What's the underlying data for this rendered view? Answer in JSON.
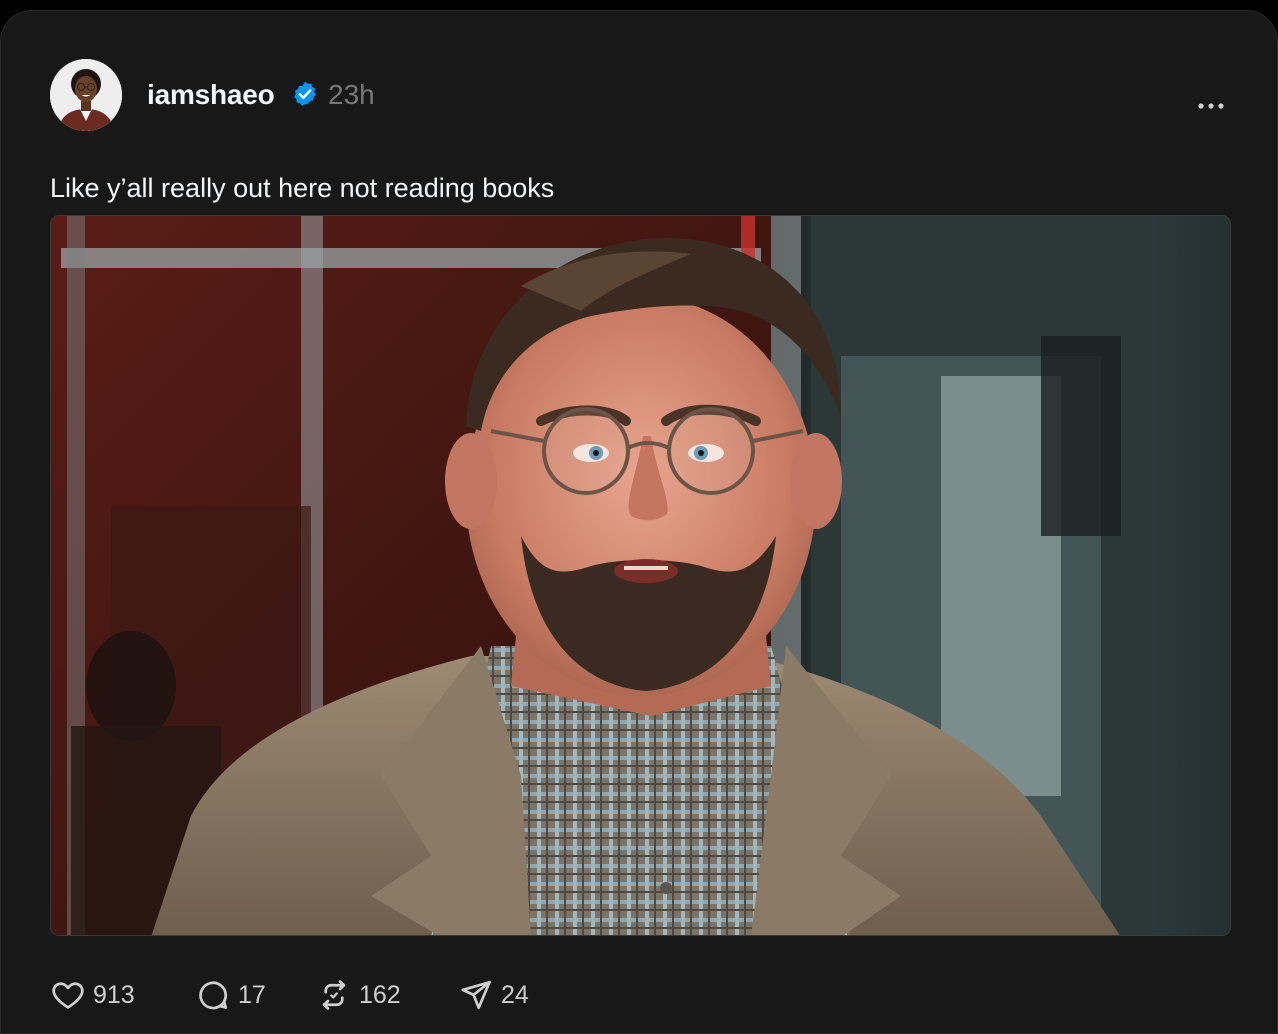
{
  "post": {
    "author": {
      "username": "iamshaeo",
      "avatar_icon": "profile-photo",
      "verified_icon": "verified-badge-icon",
      "verified_color": "#0095f6"
    },
    "timestamp": "23h",
    "more_icon": "more-horizontal-icon",
    "text": "Like y’all really out here not reading books",
    "media": {
      "type": "image",
      "description_icon": "photo"
    },
    "stats": {
      "likes": "913",
      "replies": "17",
      "reposts": "162",
      "shares": "24"
    },
    "action_icons": {
      "like": "heart-icon",
      "reply": "comment-bubble-icon",
      "repost": "repost-icon",
      "share": "send-icon"
    }
  },
  "colors": {
    "card_background": "#181818",
    "text_primary": "#f3f5f7",
    "text_secondary": "#777777",
    "accent_verified": "#0095f6"
  }
}
